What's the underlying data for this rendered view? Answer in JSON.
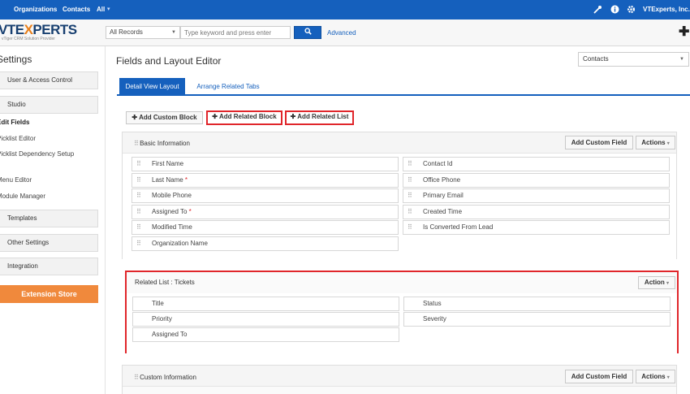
{
  "topbar": {
    "nav": [
      "Organizations",
      "Contacts",
      "All"
    ],
    "company": "VTExperts, Inc.",
    "icons": [
      "wrench-icon",
      "info-icon",
      "gear-icon"
    ]
  },
  "header": {
    "logo_main_a": "VTE",
    "logo_main_x": "X",
    "logo_main_b": "PERTS",
    "logo_sub": "vTiger CRM Solution Provider",
    "records_select": "All Records",
    "search_placeholder": "Type keyword and press enter",
    "advanced_label": "Advanced"
  },
  "sidebar": {
    "title": "Settings",
    "buttons": {
      "user_access": "User & Access Control",
      "studio": "Studio",
      "templates": "Templates",
      "other_settings": "Other Settings",
      "integration": "Integration",
      "extension_store": "Extension Store"
    },
    "studio_items": [
      "Edit Fields",
      "Picklist Editor",
      "Picklist Dependency Setup",
      "Menu Editor",
      "Module Manager"
    ]
  },
  "main": {
    "title": "Fields and Layout Editor",
    "module": "Contacts",
    "tabs": [
      "Detail View Layout",
      "Arrange Related Tabs"
    ],
    "toolbar": {
      "add_custom_block": "Add Custom Block",
      "add_related_block": "Add Related Block",
      "add_related_list": "Add Related List"
    },
    "basic": {
      "title": "Basic Information",
      "add_custom_field": "Add Custom Field",
      "actions": "Actions",
      "left": [
        "First Name",
        "Last Name",
        "Mobile Phone",
        "Assigned To",
        "Modified Time",
        "Organization Name"
      ],
      "right": [
        "Contact Id",
        "Office Phone",
        "Primary Email",
        "Created Time",
        "Is Converted From Lead"
      ],
      "required_mark": "*"
    },
    "related": {
      "title": "Related List : Tickets",
      "action": "Action",
      "left": [
        "Title",
        "Priority",
        "Assigned To"
      ],
      "right": [
        "Status",
        "Severity"
      ]
    },
    "custom": {
      "title": "Custom Information",
      "add_custom_field": "Add Custom Field",
      "actions": "Actions"
    }
  }
}
